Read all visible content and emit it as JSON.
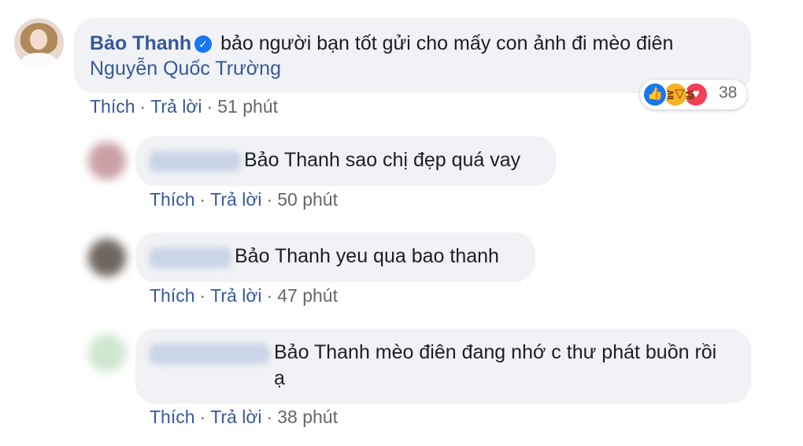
{
  "main_comment": {
    "author": "Bảo Thanh",
    "text": "bảo người bạn tốt gửi cho mấy con ảnh đi mèo điên",
    "mention": "Nguyễn Quốc Trường",
    "reaction_count": "38",
    "reaction_icons": [
      "like-icon",
      "haha-icon",
      "love-icon"
    ],
    "actions": {
      "like": "Thích",
      "reply": "Trả lời",
      "time": "51 phút"
    }
  },
  "replies": [
    {
      "text": "Bảo Thanh sao chị đẹp quá vay",
      "actions": {
        "like": "Thích",
        "reply": "Trả lời",
        "time": "50 phút"
      }
    },
    {
      "text": "Bảo Thanh yeu qua bao thanh",
      "actions": {
        "like": "Thích",
        "reply": "Trả lời",
        "time": "47 phút"
      }
    },
    {
      "text": "Bảo Thanh mèo điên đang nhớ c thư phát buồn rồi ạ",
      "actions": {
        "like": "Thích",
        "reply": "Trả lời",
        "time": "38 phút"
      }
    }
  ],
  "separator": "·",
  "colors": {
    "link": "#385898",
    "bubble": "#f0f2f5",
    "meta": "#65676b",
    "like": "#1877f2",
    "love": "#f33e58",
    "haha": "#f7b125"
  }
}
